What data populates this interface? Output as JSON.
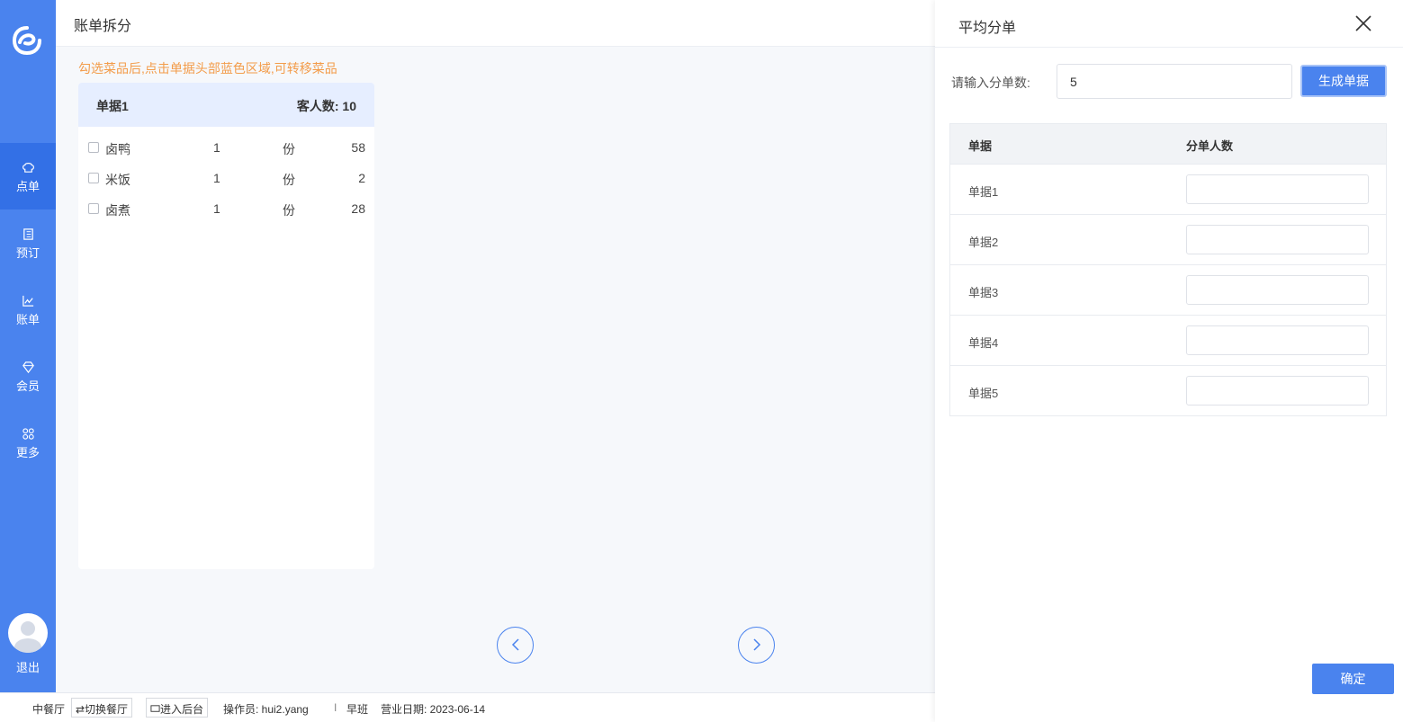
{
  "sidebar": {
    "items": [
      {
        "label": "点单",
        "icon": "chef-hat-icon",
        "active": true
      },
      {
        "label": "预订",
        "icon": "book-icon"
      },
      {
        "label": "账单",
        "icon": "chart-icon"
      },
      {
        "label": "会员",
        "icon": "diamond-icon"
      },
      {
        "label": "更多",
        "icon": "grid-icon"
      }
    ],
    "logout_label": "退出"
  },
  "main": {
    "title": "账单拆分",
    "hint": "勾选菜品后,点击单据头部蓝色区域,可转移菜品",
    "bill": {
      "name": "单据1",
      "guests_label": "客人数: 10",
      "dishes": [
        {
          "name": "卤鸭",
          "qty": "1",
          "unit": "份",
          "price": "58"
        },
        {
          "name": "米饭",
          "qty": "1",
          "unit": "份",
          "price": "2"
        },
        {
          "name": "卤煮",
          "qty": "1",
          "unit": "份",
          "price": "28"
        }
      ]
    }
  },
  "statusbar": {
    "restaurant": "中餐厅",
    "switch_label": "⇄切换餐厅",
    "backend_label": "进入后台",
    "operator": "操作员: hui2.yang",
    "separator": "I",
    "shift": "早班",
    "business_date": "营业日期: 2023-06-14"
  },
  "drawer": {
    "title": "平均分单",
    "split_label": "请输入分单数:",
    "split_value": "5",
    "generate_label": "生成单据",
    "table": {
      "headers": [
        "单据",
        "分单人数"
      ],
      "rows": [
        "单据1",
        "单据2",
        "单据3",
        "单据4",
        "单据5"
      ]
    },
    "confirm_label": "确定"
  },
  "colors": {
    "primary": "#4a83ee",
    "hint": "#f39c4a",
    "bill_head": "#e6eeff"
  }
}
